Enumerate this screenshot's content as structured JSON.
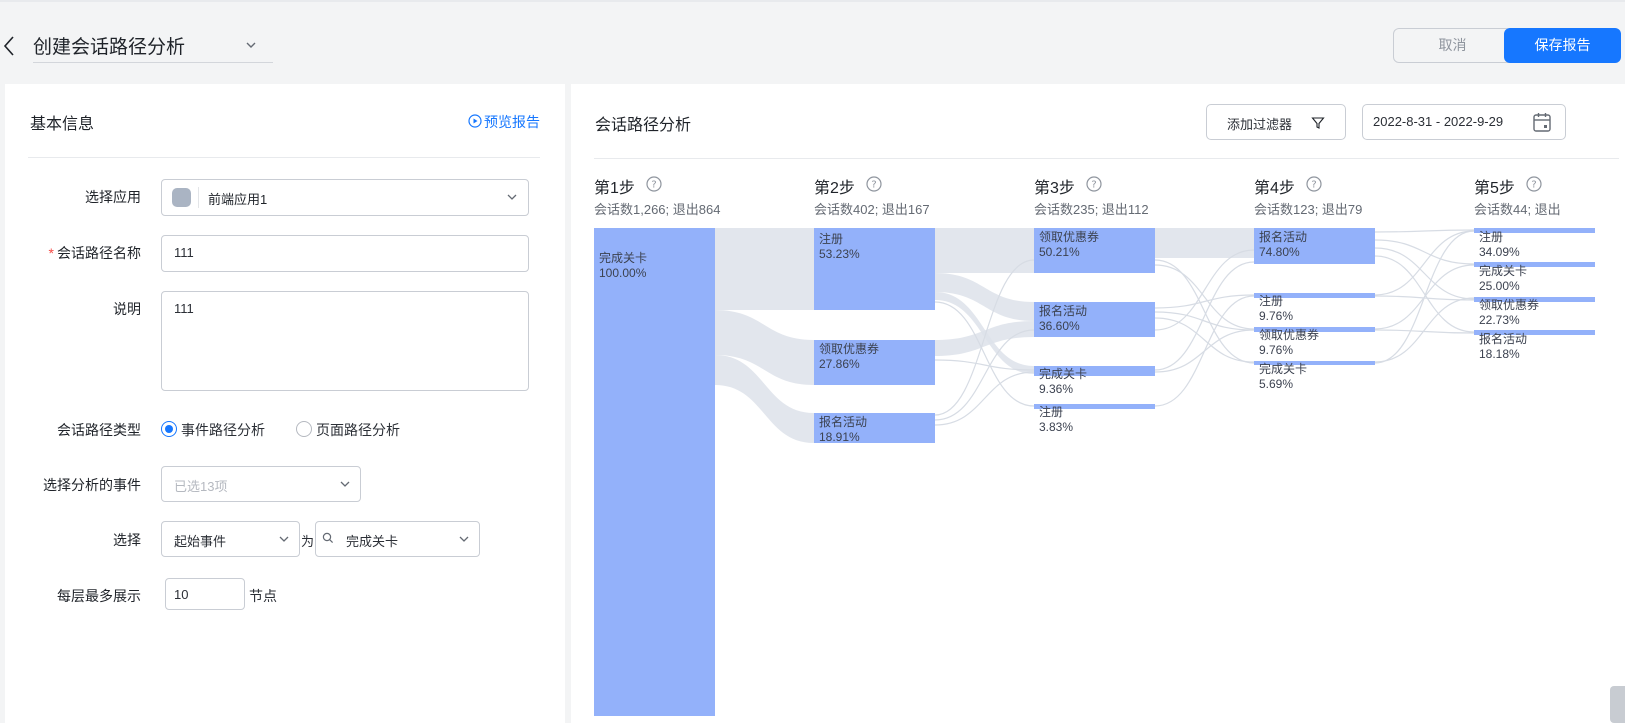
{
  "header": {
    "title": "创建会话路径分析",
    "cancel_label": "取消",
    "save_label": "保存报告"
  },
  "basic": {
    "title": "基本信息",
    "preview_label": "预览报告",
    "fields": {
      "app_label": "选择应用",
      "app_value": "前端应用1",
      "name_label": "会话路径名称",
      "name_value": "111",
      "desc_label": "说明",
      "desc_value": "111",
      "type_label": "会话路径类型",
      "type_options": [
        "事件路径分析",
        "页面路径分析"
      ],
      "type_selected": "事件路径分析",
      "events_label": "选择分析的事件",
      "events_placeholder": "已选13项",
      "select_label": "选择",
      "start_value": "起始事件",
      "as_label": "为",
      "event_value": "完成关卡",
      "max_label": "每层最多展示",
      "max_value": "10",
      "max_unit": "节点"
    }
  },
  "analysis": {
    "title": "会话路径分析",
    "filter_label": "添加过滤器",
    "date_range": "2022-8-31 - 2022-9-29",
    "colors": {
      "node": "#93b1fa",
      "link": "#dde2ea",
      "primary": "#1677ff"
    },
    "steps": [
      {
        "title": "第1步",
        "sub": "会话数1,266; 退出864",
        "nodes": [
          {
            "name": "完成关卡",
            "pct": "100.00%"
          }
        ]
      },
      {
        "title": "第2步",
        "sub": "会话数402; 退出167",
        "nodes": [
          {
            "name": "注册",
            "pct": "53.23%"
          },
          {
            "name": "领取优惠券",
            "pct": "27.86%"
          },
          {
            "name": "报名活动",
            "pct": "18.91%"
          }
        ]
      },
      {
        "title": "第3步",
        "sub": "会话数235; 退出112",
        "nodes": [
          {
            "name": "领取优惠券",
            "pct": "50.21%"
          },
          {
            "name": "报名活动",
            "pct": "36.60%"
          },
          {
            "name": "完成关卡",
            "pct": "9.36%"
          },
          {
            "name": "注册",
            "pct": "3.83%"
          }
        ]
      },
      {
        "title": "第4步",
        "sub": "会话数123; 退出79",
        "nodes": [
          {
            "name": "报名活动",
            "pct": "74.80%"
          },
          {
            "name": "注册",
            "pct": "9.76%"
          },
          {
            "name": "领取优惠券",
            "pct": "9.76%"
          },
          {
            "name": "完成关卡",
            "pct": "5.69%"
          }
        ]
      },
      {
        "title": "第5步",
        "sub": "会话数44; 退出",
        "nodes": [
          {
            "name": "注册",
            "pct": "34.09%"
          },
          {
            "name": "完成关卡",
            "pct": "25.00%"
          },
          {
            "name": "领取优惠券",
            "pct": "22.73%"
          },
          {
            "name": "报名活动",
            "pct": "18.18%"
          }
        ]
      }
    ]
  }
}
